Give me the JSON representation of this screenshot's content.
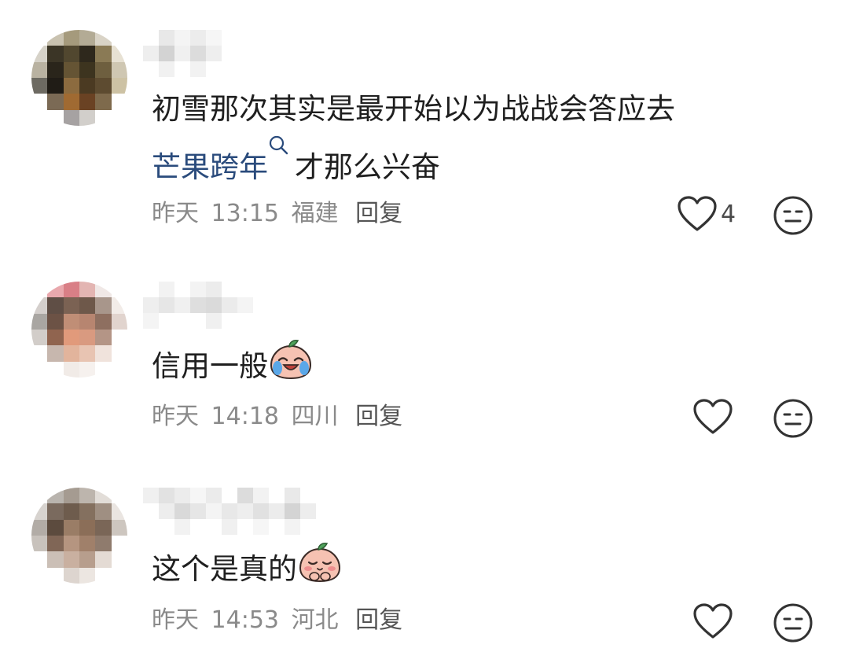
{
  "comments": [
    {
      "content_text": "初雪那次其实是最开始以为战战会答应去",
      "topic_link": "芒果跨年",
      "content_text_after_topic": "才那么兴奋",
      "meta": {
        "date": "昨天",
        "time": "13:15",
        "location": "福建",
        "reply_label": "回复"
      },
      "like_count": "4"
    },
    {
      "content_text": "信用一般",
      "emoji": "crying-laughing-peach-emoji",
      "meta": {
        "date": "昨天",
        "time": "14:18",
        "location": "四川",
        "reply_label": "回复"
      },
      "like_count": ""
    },
    {
      "content_text": "这个是真的",
      "emoji": "blushing-peach-emoji",
      "meta": {
        "date": "昨天",
        "time": "14:53",
        "location": "河北",
        "reply_label": "回复"
      },
      "like_count": ""
    }
  ],
  "icons": {
    "like": "heart-icon",
    "dislike": "meh-face-icon",
    "topic": "search-icon"
  },
  "colors": {
    "text": "#1f1f1f",
    "meta": "#8a8a8a",
    "topic_link": "#2a4b7c",
    "icon": "#333333"
  }
}
